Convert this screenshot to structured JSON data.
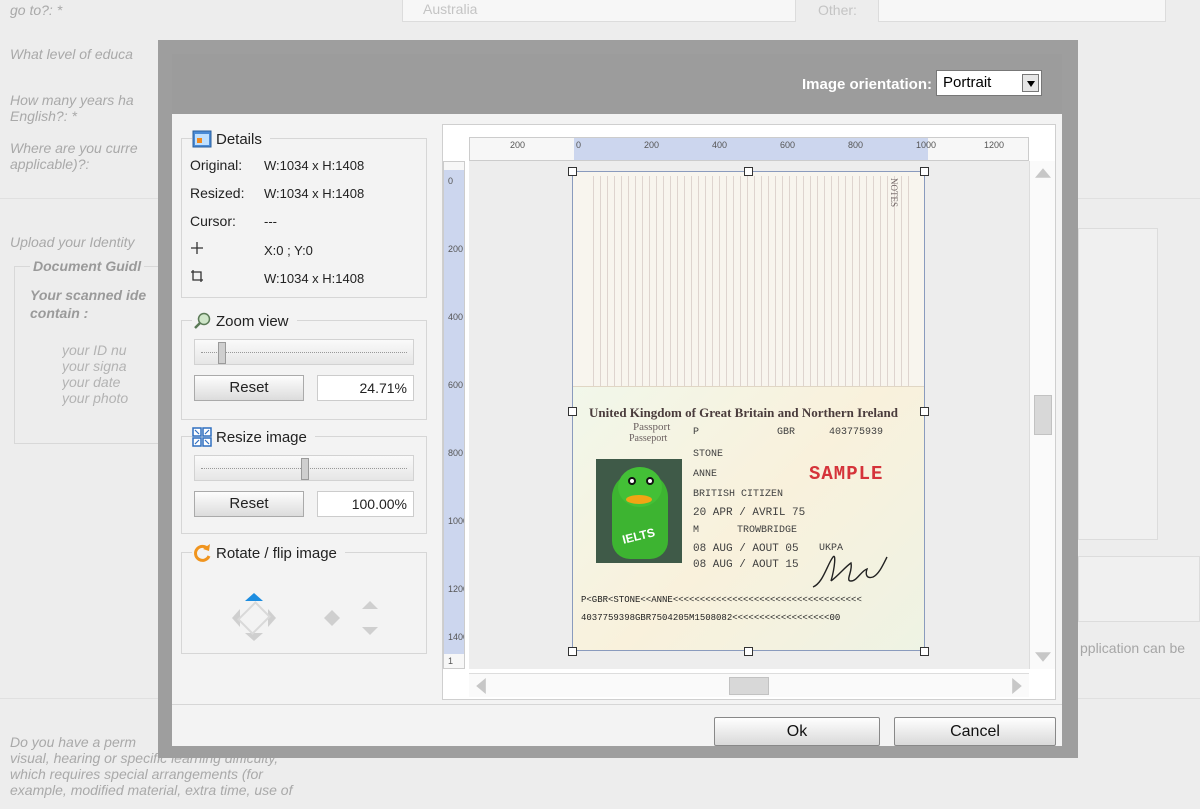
{
  "background_form": {
    "q_go_to": "go to?: *",
    "q_country_value": "Australia",
    "q_other_label": "Other:",
    "q_education": "What level of educa",
    "q_years": "How many years ha",
    "q_years_2": "English?: *",
    "q_where": "Where are you curre",
    "q_where_2": "applicable)?:",
    "q_upload": "Upload your Identity",
    "guide_title": "Document Guidl",
    "guide_sub": "Your scanned ide contain :",
    "guide_items": [
      "your ID nu",
      "your signa",
      "your date",
      "your photo"
    ],
    "right_partial": "pplication can be",
    "q_disability": "Do you have a perm",
    "q_disability_2": "visual, hearing or specific learning difficulty,",
    "q_disability_3": "which requires special arrangements (for",
    "q_disability_4": "example, modified material, extra time, use of"
  },
  "modal": {
    "orientation_label": "Image orientation:",
    "orientation_value": "Portrait",
    "details": {
      "title": "Details",
      "original_label": "Original:",
      "original_value": "W:1034 x H:1408",
      "resized_label": "Resized:",
      "resized_value": "W:1034 x H:1408",
      "cursor_label": "Cursor:",
      "cursor_value": "---",
      "position_value": "X:0 ; Y:0",
      "crop_value": "W:1034 x H:1408"
    },
    "zoom": {
      "title": "Zoom view",
      "reset_label": "Reset",
      "value": "24.71%",
      "level": 0.1
    },
    "resize": {
      "title": "Resize image",
      "reset_label": "Reset",
      "value": "100.00%",
      "level": 0.5
    },
    "rotate": {
      "title": "Rotate / flip image"
    },
    "ruler_top": [
      "200",
      "0",
      "200",
      "400",
      "600",
      "800",
      "1000",
      "1200"
    ],
    "ruler_left": [
      "0",
      "200",
      "400",
      "600",
      "800",
      "1000",
      "1200",
      "1400",
      "1"
    ],
    "passport": {
      "notes_heading": "NOTES",
      "country_title": "United Kingdom of Great Britain and Northern Ireland",
      "passport_en": "Passport",
      "passport_fr": "Passeport",
      "type": "P",
      "code": "GBR",
      "number": "403775939",
      "surname": "STONE",
      "given_name": "ANNE",
      "nationality": "BRITISH CITIZEN",
      "dob": "20 APR  / AVRIL 75",
      "sex": "M",
      "place_of_birth": "TROWBRIDGE",
      "issue_date": "08 AUG  / AOUT 05",
      "authority": "UKPA",
      "expiry_date": "08 AUG  / AOUT 15",
      "sample_stamp": "SAMPLE",
      "photo_text": "IELTS",
      "mrz_line1": "P<GBR<STONE<<ANNE<<<<<<<<<<<<<<<<<<<<<<<<<<<<<<<<<<<",
      "mrz_line2": "4037759398GBR7504205M1508082<<<<<<<<<<<<<<<<<<00"
    },
    "ok_label": "Ok",
    "cancel_label": "Cancel"
  }
}
